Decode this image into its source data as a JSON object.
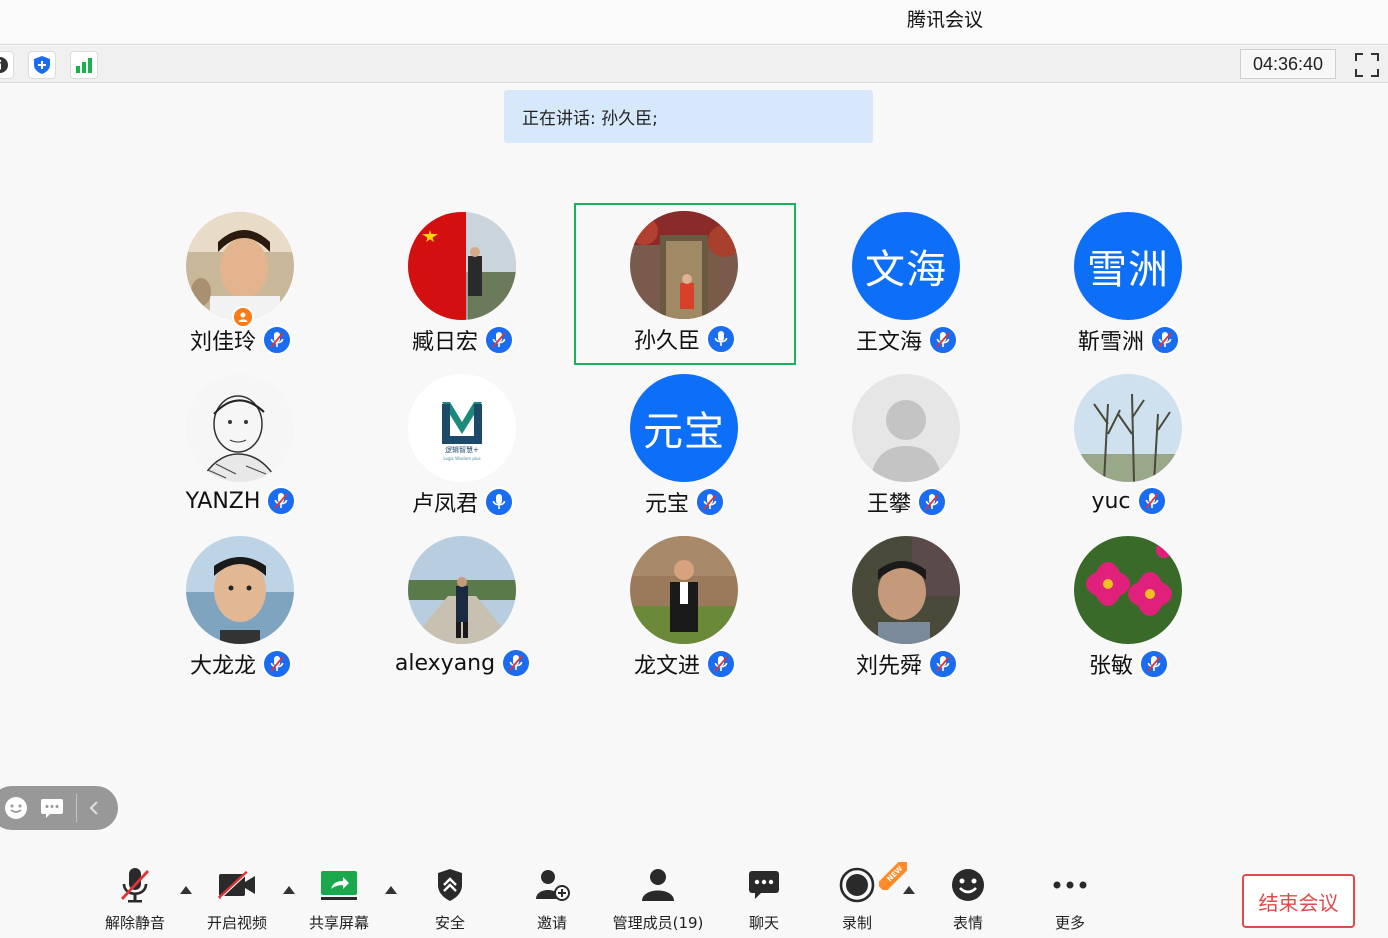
{
  "window": {
    "title": "腾讯会议"
  },
  "top_toolbar": {
    "timer": "04:36:40"
  },
  "speaking": {
    "text": "正在讲话: 孙久臣;"
  },
  "participants": [
    {
      "name": "刘佳玲",
      "avatar": "photo-man",
      "host": true,
      "mic": "muted"
    },
    {
      "name": "臧日宏",
      "avatar": "photo-flag",
      "mic": "muted"
    },
    {
      "name": "孙久臣",
      "avatar": "photo-door",
      "mic": "active",
      "speaking": true
    },
    {
      "name": "王文海",
      "avatar_text": "文海",
      "mic": "muted"
    },
    {
      "name": "靳雪洲",
      "avatar_text": "雪洲",
      "mic": "muted"
    },
    {
      "name": "YANZH",
      "avatar": "photo-sketch",
      "mic": "muted"
    },
    {
      "name": "卢凤君",
      "avatar": "logo",
      "logo_text": "逻辑智慧+",
      "mic": "active"
    },
    {
      "name": "元宝",
      "avatar_text": "元宝",
      "mic": "muted"
    },
    {
      "name": "王攀",
      "avatar": "default",
      "mic": "muted"
    },
    {
      "name": "yuc",
      "avatar": "photo-trees",
      "mic": "muted"
    },
    {
      "name": "大龙龙",
      "avatar": "photo-boy",
      "mic": "muted"
    },
    {
      "name": "alexyang",
      "avatar": "photo-road",
      "mic": "muted"
    },
    {
      "name": "龙文进",
      "avatar": "photo-field",
      "mic": "muted"
    },
    {
      "name": "刘先舜",
      "avatar": "photo-child",
      "mic": "muted"
    },
    {
      "name": "张敏",
      "avatar": "photo-flowers",
      "mic": "muted"
    }
  ],
  "bottom_toolbar": {
    "unmute": "解除静音",
    "start_video": "开启视频",
    "share_screen": "共享屏幕",
    "security": "安全",
    "invite": "邀请",
    "manage_members": "管理成员(19)",
    "chat": "聊天",
    "record": "录制",
    "record_badge": "NEW",
    "emoji": "表情",
    "more": "更多",
    "end_meeting": "结束会议"
  },
  "colors": {
    "accent": "#1a6cf0",
    "speaking_border": "#18b35a",
    "end": "#e04a4a",
    "host_badge": "#ff7a14"
  }
}
